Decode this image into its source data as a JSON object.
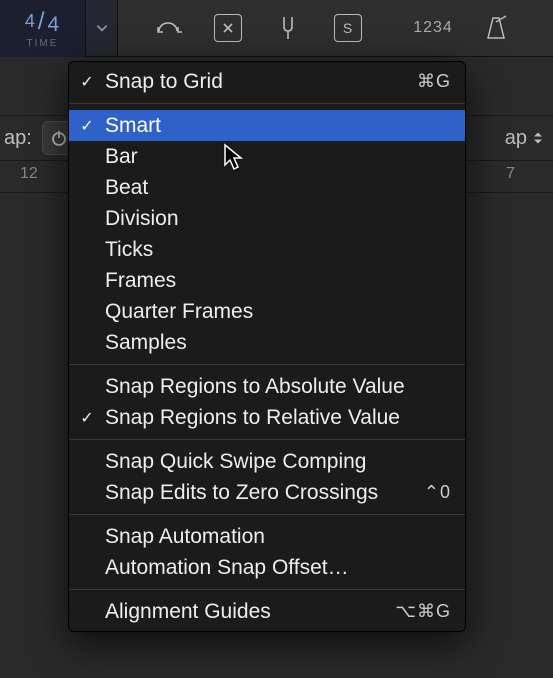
{
  "toolbar": {
    "time_sig_num": "4",
    "time_sig_den": "4",
    "time_label": "TIME",
    "bar_numbers": "1234",
    "solo_label": "S"
  },
  "snap_row": {
    "prefix": "ap:",
    "suffix": "ap"
  },
  "ruler": {
    "left": "12",
    "right": "7"
  },
  "menu": {
    "snap_to_grid": "Snap to Grid",
    "snap_to_grid_sc": "⌘G",
    "smart": "Smart",
    "bar": "Bar",
    "beat": "Beat",
    "division": "Division",
    "ticks": "Ticks",
    "frames": "Frames",
    "quarter_frames": "Quarter Frames",
    "samples": "Samples",
    "abs_value": "Snap Regions to Absolute Value",
    "rel_value": "Snap Regions to Relative Value",
    "quick_swipe": "Snap Quick Swipe Comping",
    "zero_cross": "Snap Edits to Zero Crossings",
    "zero_cross_sc": "⌃0",
    "snap_auto": "Snap Automation",
    "auto_offset": "Automation Snap Offset…",
    "align_guides": "Alignment Guides",
    "align_guides_sc": "⌥⌘G"
  }
}
